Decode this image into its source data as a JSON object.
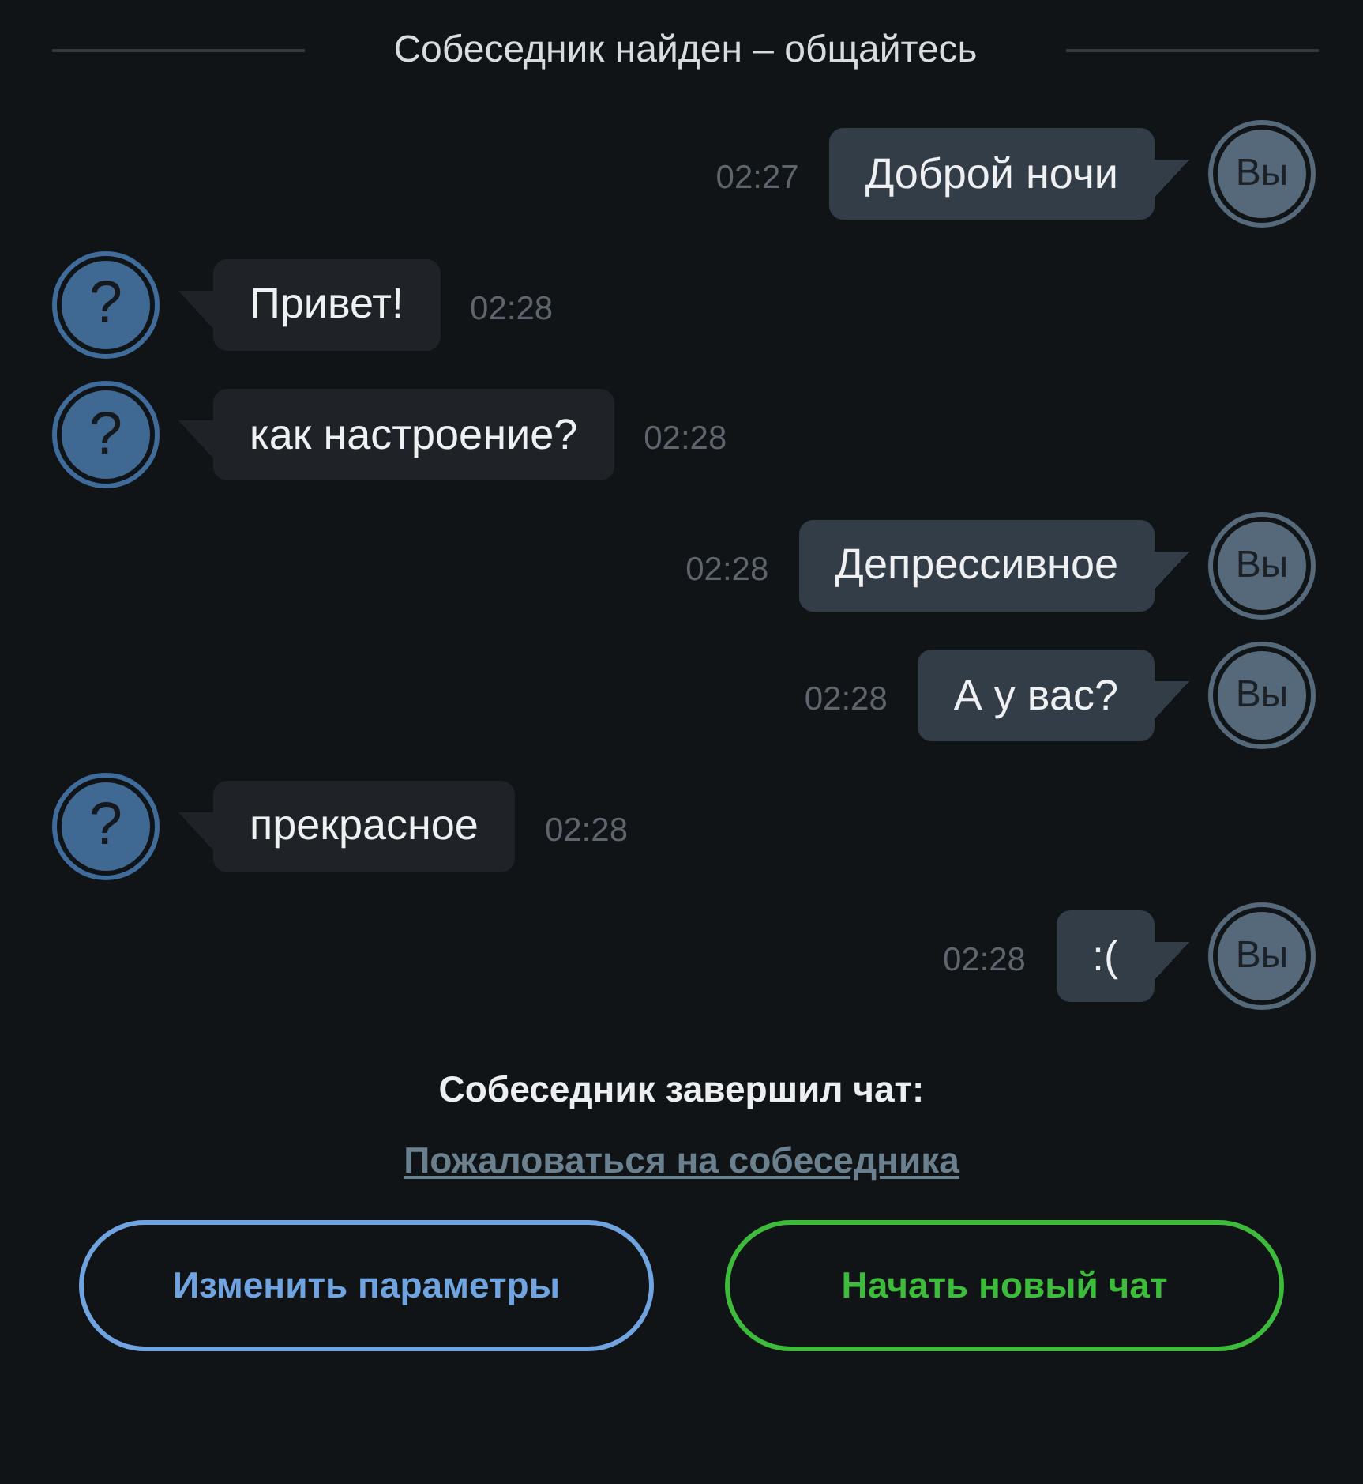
{
  "status_divider": {
    "text": "Собеседник найден – общайтесь"
  },
  "messages": [
    {
      "kind": "outgoing",
      "avatar_label": "Вы",
      "text": "Доброй ночи",
      "time": "02:27"
    },
    {
      "kind": "incoming",
      "avatar_label": "?",
      "text": "Привет!",
      "time": "02:28"
    },
    {
      "kind": "incoming",
      "avatar_label": "?",
      "text": "как настроение?",
      "time": "02:28"
    },
    {
      "kind": "outgoing",
      "avatar_label": "Вы",
      "text": "Депрессивное",
      "time": "02:28"
    },
    {
      "kind": "outgoing",
      "avatar_label": "Вы",
      "text": "А у вас?",
      "time": "02:28"
    },
    {
      "kind": "incoming",
      "avatar_label": "?",
      "text": "прекрасное",
      "time": "02:28"
    },
    {
      "kind": "outgoing",
      "avatar_label": "Вы",
      "text": ":(",
      "time": "02:28"
    }
  ],
  "chat_ended": {
    "notice": "Собеседник завершил чат:",
    "report_link": "Пожаловаться на собеседника"
  },
  "buttons": [
    {
      "label": "Изменить параметры",
      "color": "#6fa4e0"
    },
    {
      "label": "Начать новый чат",
      "color": "#3dbb3a"
    }
  ]
}
